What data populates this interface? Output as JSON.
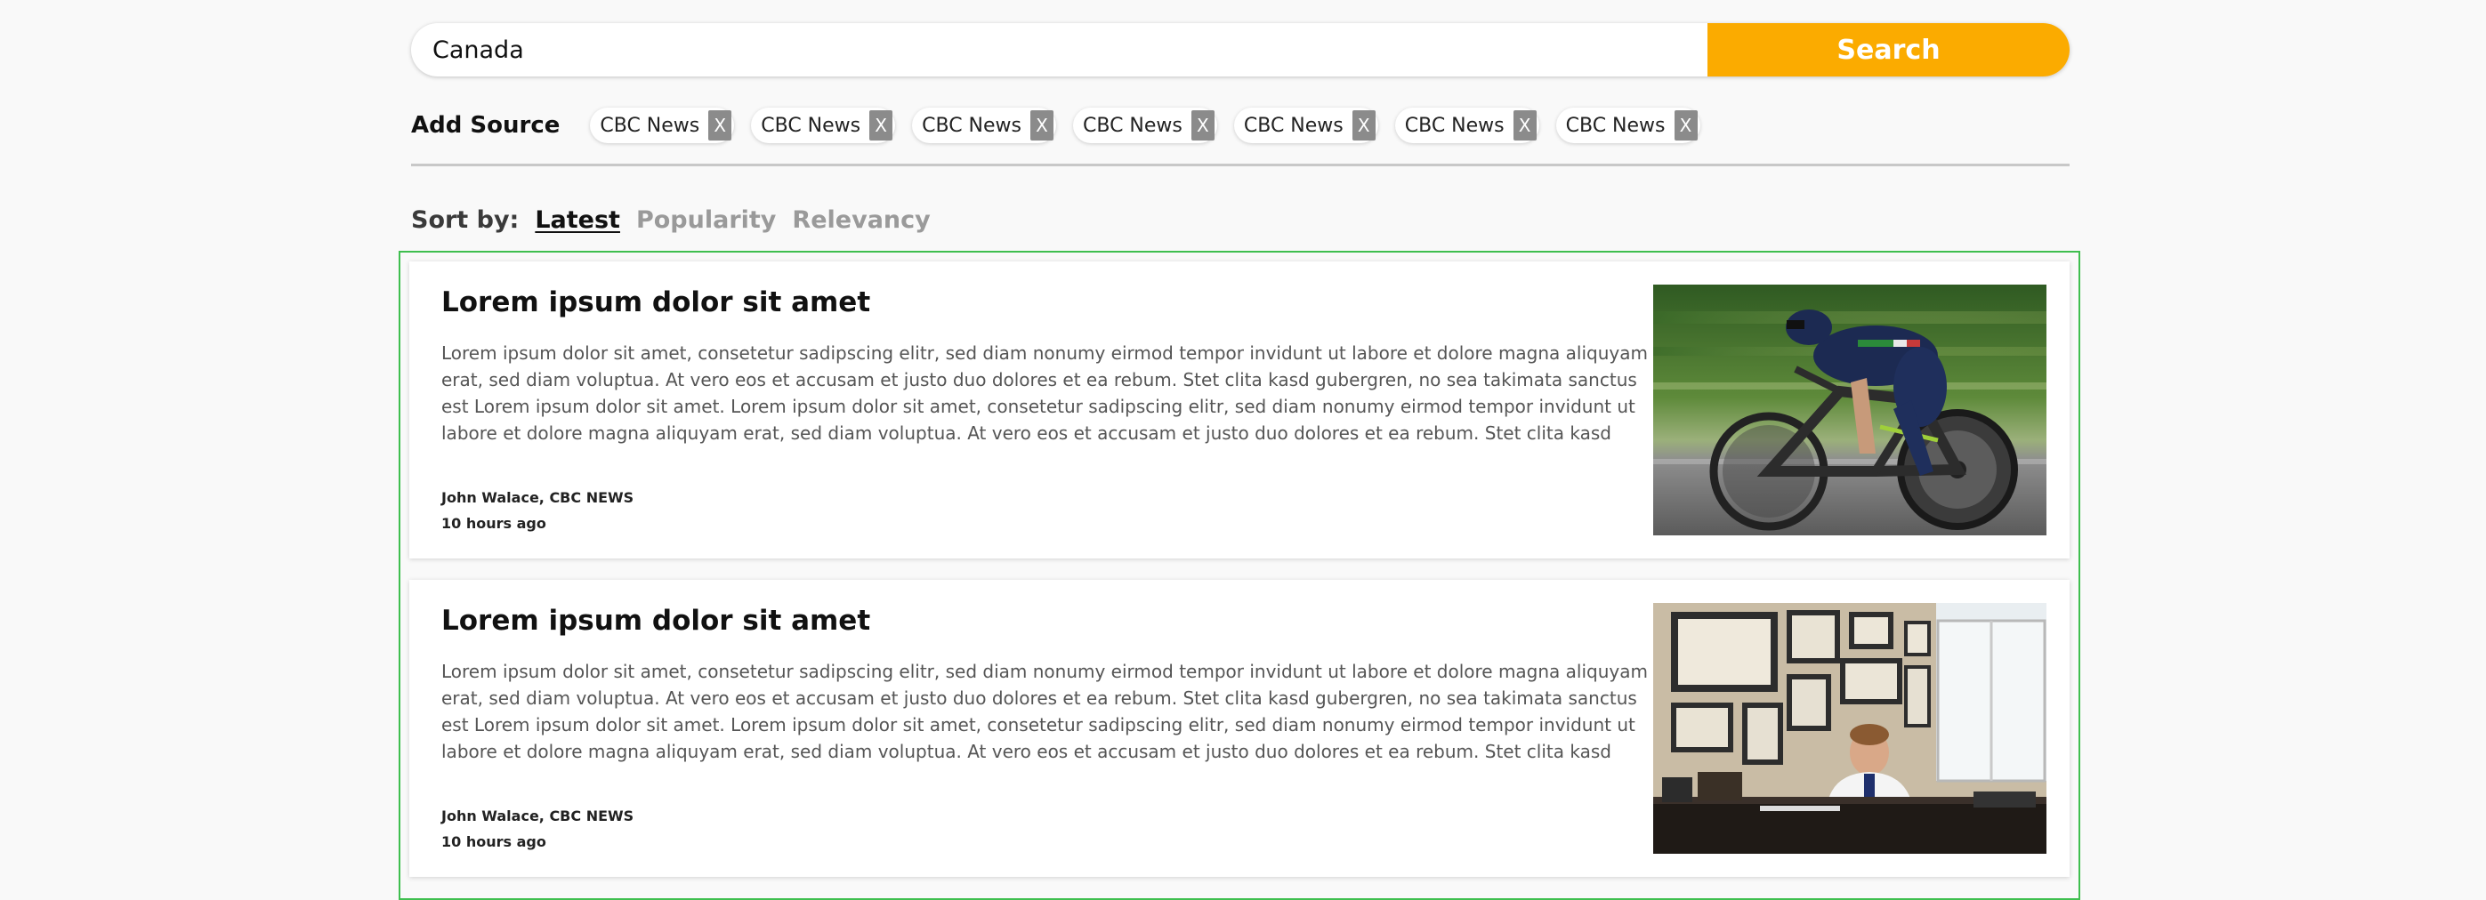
{
  "search": {
    "value": "Canada",
    "button_label": "Search"
  },
  "sources": {
    "label": "Add Source",
    "chips": [
      {
        "label": "CBC News",
        "remove": "X"
      },
      {
        "label": "CBC News",
        "remove": "X"
      },
      {
        "label": "CBC News",
        "remove": "X"
      },
      {
        "label": "CBC News",
        "remove": "X"
      },
      {
        "label": "CBC News",
        "remove": "X"
      },
      {
        "label": "CBC News",
        "remove": "X"
      },
      {
        "label": "CBC News",
        "remove": "X"
      }
    ]
  },
  "sort": {
    "label": "Sort by:",
    "options": [
      "Latest",
      "Popularity",
      "Relevancy"
    ],
    "active": "Latest"
  },
  "articles": [
    {
      "title": "Lorem ipsum dolor sit amet",
      "body": "Lorem ipsum dolor sit amet, consetetur sadipscing elitr, sed diam nonumy eirmod tempor invidunt ut labore et dolore magna aliquyam erat, sed diam voluptua. At vero eos et accusam et justo duo dolores et ea rebum. Stet clita kasd gubergren, no sea takimata sanctus est Lorem ipsum dolor sit amet. Lorem ipsum dolor sit amet, consetetur sadipscing elitr, sed diam nonumy eirmod tempor invidunt ut labore et dolore magna aliquyam erat, sed diam voluptua. At vero eos et accusam et justo duo dolores et ea rebum. Stet clita kasd",
      "author": "John Walace, CBC NEWS",
      "time": "10 hours ago",
      "image": "cyclist-photo"
    },
    {
      "title": "Lorem ipsum dolor sit amet",
      "body": "Lorem ipsum dolor sit amet, consetetur sadipscing elitr, sed diam nonumy eirmod tempor invidunt ut labore et dolore magna aliquyam erat, sed diam voluptua. At vero eos et accusam et justo duo dolores et ea rebum. Stet clita kasd gubergren, no sea takimata sanctus est Lorem ipsum dolor sit amet. Lorem ipsum dolor sit amet, consetetur sadipscing elitr, sed diam nonumy eirmod tempor invidunt ut labore et dolore magna aliquyam erat, sed diam voluptua. At vero eos et accusam et justo duo dolores et ea rebum. Stet clita kasd",
      "author": "John Walace, CBC NEWS",
      "time": "10 hours ago",
      "image": "doctor-office-photo"
    }
  ],
  "colors": {
    "accent": "#fbab00",
    "selection_border": "#3fbf4f",
    "chip_remove": "#8b8b8b"
  }
}
